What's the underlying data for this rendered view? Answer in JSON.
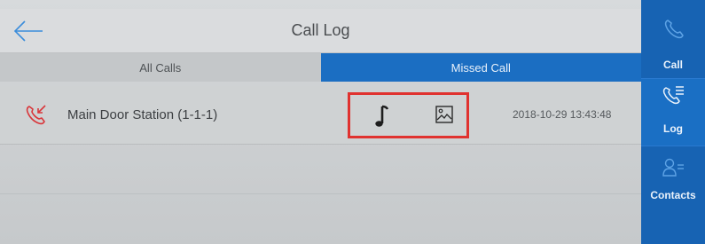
{
  "header": {
    "title": "Call Log"
  },
  "tabs": [
    {
      "label": "All Calls",
      "active": false
    },
    {
      "label": "Missed Call",
      "active": true
    }
  ],
  "call_log": [
    {
      "name": "Main Door Station (1-1-1)",
      "time": "2018-10-29 13:43:48",
      "status_icon": "missed-call-icon",
      "media": [
        "music-note-icon",
        "image-icon"
      ]
    }
  ],
  "sidebar": {
    "items": [
      {
        "label": "Call",
        "icon": "phone-icon",
        "active": false
      },
      {
        "label": "Log",
        "icon": "call-log-icon",
        "active": true
      },
      {
        "label": "Contacts",
        "icon": "contacts-icon",
        "active": false
      }
    ]
  },
  "colors": {
    "accent": "#1b6ec2",
    "sidebar": "#1763b3",
    "missed_red": "#d9363a",
    "highlight_box": "#e0322f"
  }
}
